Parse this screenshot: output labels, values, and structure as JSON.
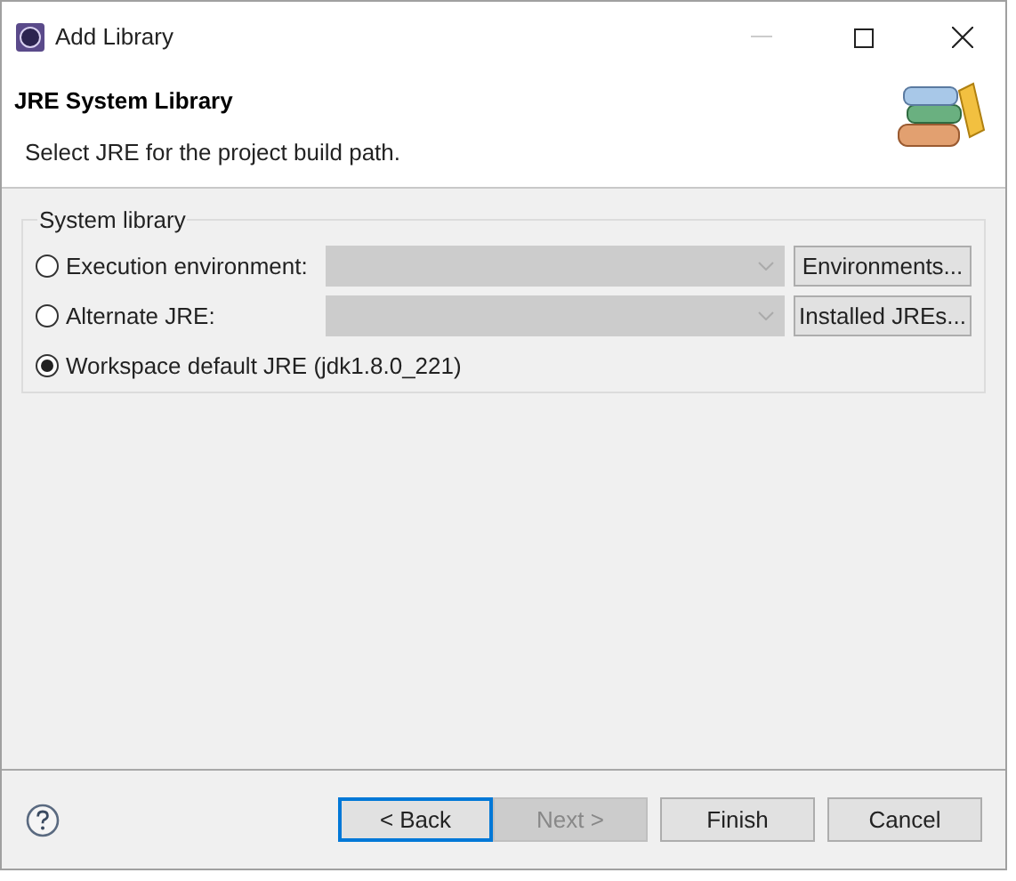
{
  "window": {
    "title": "Add Library"
  },
  "header": {
    "title": "JRE System Library",
    "description": "Select JRE for the project build path."
  },
  "group": {
    "label": "System library",
    "options": [
      {
        "label": "Execution environment:",
        "selected": false,
        "combo_disabled": true,
        "button": "Environments..."
      },
      {
        "label": "Alternate JRE:",
        "selected": false,
        "combo_disabled": true,
        "button": "Installed JREs..."
      },
      {
        "label": "Workspace default JRE (jdk1.8.0_221)",
        "selected": true
      }
    ]
  },
  "buttons": [
    {
      "label": "< Back",
      "disabled": false,
      "default": true
    },
    {
      "label": "Next >",
      "disabled": true,
      "default": false
    },
    {
      "label": "Finish",
      "disabled": false,
      "default": false
    },
    {
      "label": "Cancel",
      "disabled": false,
      "default": false
    }
  ]
}
